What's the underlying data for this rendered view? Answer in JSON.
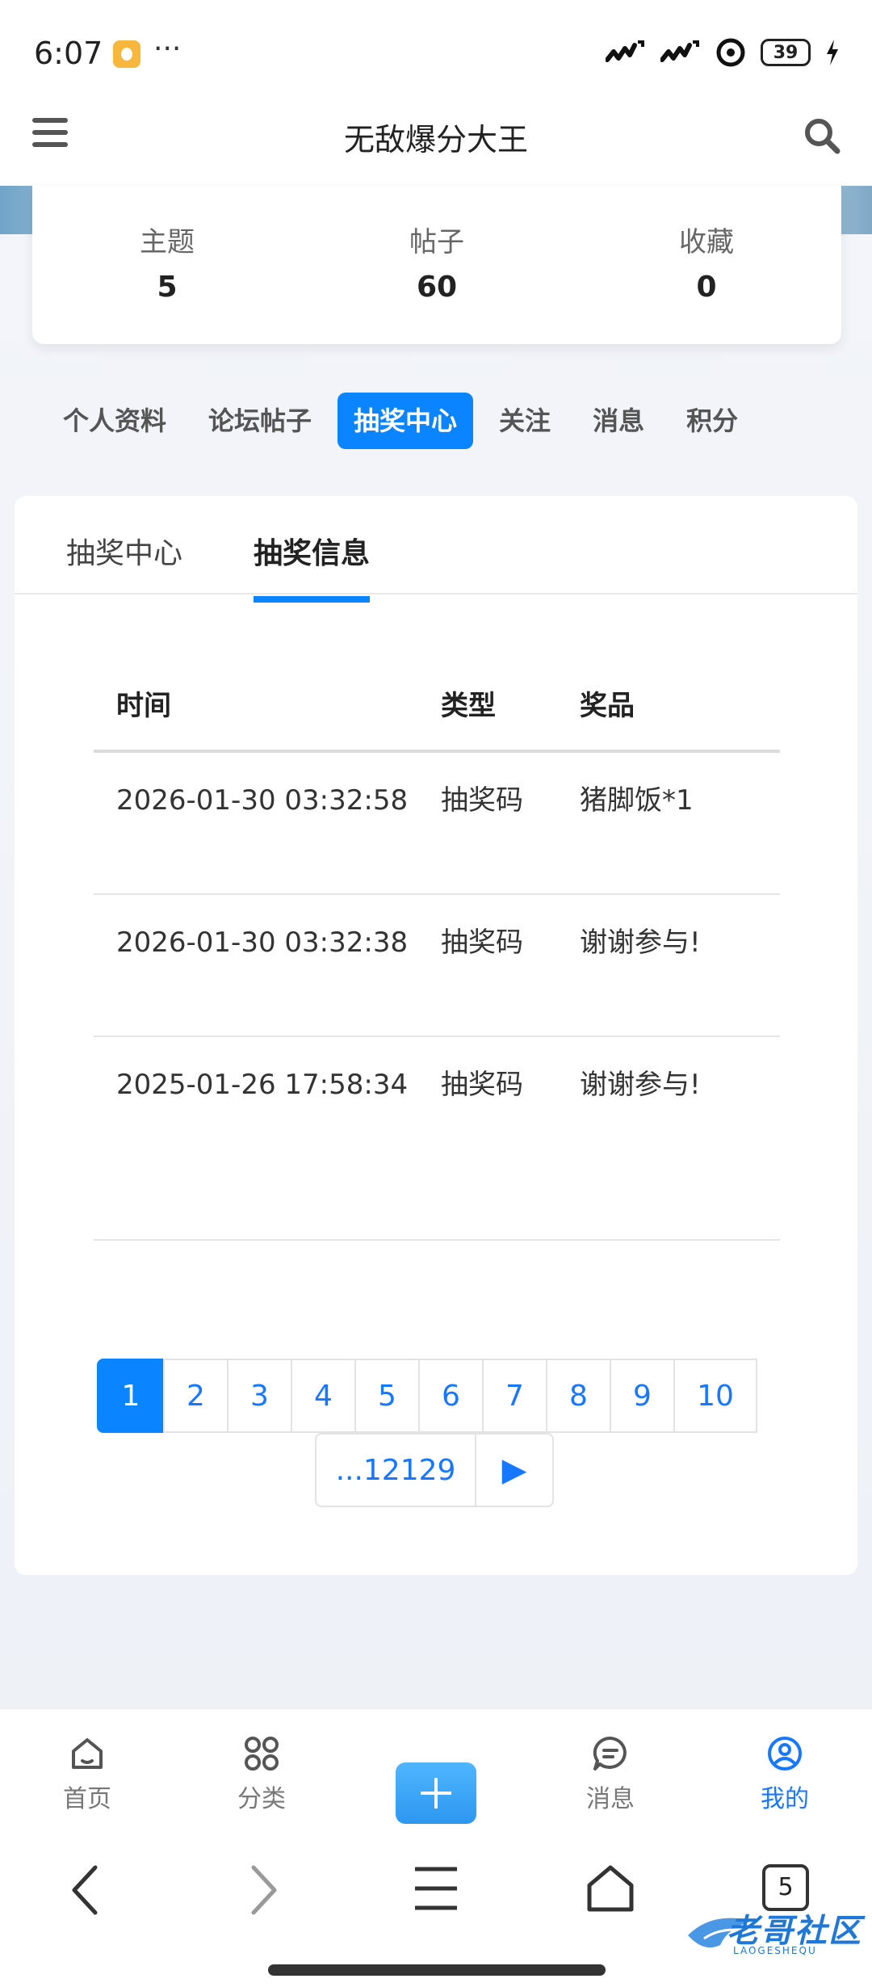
{
  "status_bar": {
    "time": "6:07",
    "dots": "···",
    "battery": "39"
  },
  "header": {
    "title": "无敌爆分大王"
  },
  "stats": [
    {
      "label": "主题",
      "value": "5"
    },
    {
      "label": "帖子",
      "value": "60"
    },
    {
      "label": "收藏",
      "value": "0"
    }
  ],
  "nav_tabs": [
    "个人资料",
    "论坛帖子",
    "抽奖中心",
    "关注",
    "消息",
    "积分"
  ],
  "sub_tabs": [
    "抽奖中心",
    "抽奖信息"
  ],
  "table": {
    "headers": [
      "时间",
      "类型",
      "奖品"
    ],
    "rows": [
      {
        "time": "2026-01-30 03:32:58",
        "type": "抽奖码",
        "prize": "猪脚饭*1"
      },
      {
        "time": "2026-01-30 03:32:38",
        "type": "抽奖码",
        "prize": "谢谢参与!"
      },
      {
        "time": "2025-01-26 17:58:34",
        "type": "抽奖码",
        "prize": "谢谢参与!"
      }
    ]
  },
  "pagination": {
    "pages": [
      "1",
      "2",
      "3",
      "4",
      "5",
      "6",
      "7",
      "8",
      "9",
      "10"
    ],
    "more": "...12129",
    "next": "▶"
  },
  "bottom_nav": [
    {
      "label": "首页"
    },
    {
      "label": "分类"
    },
    {
      "label": ""
    },
    {
      "label": "消息"
    },
    {
      "label": "我的"
    }
  ],
  "system_nav": {
    "tab_count": "5"
  },
  "watermark": {
    "text": "老哥社区",
    "sub": "LAOGESHEQU"
  },
  "colors": {
    "accent": "#0a84ff",
    "link": "#1677ff"
  }
}
